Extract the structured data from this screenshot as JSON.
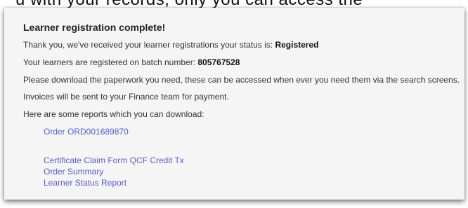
{
  "background_text": "u with your records, only you can access the",
  "heading": "Learner registration complete!",
  "messages": {
    "status_prefix": "Thank you, we've received your learner registrations your status is: ",
    "status_value": "Registered",
    "batch_prefix": "Your learners are registered on batch number: ",
    "batch_value": "805767528",
    "paperwork": "Please download the paperwork you need, these can be accessed when ever you need them via the search screens.",
    "invoices": "Invoices will be sent to your Finance team for payment.",
    "reports_intro": "Here are some reports which you can download:"
  },
  "links": {
    "order": "Order ORD001689870",
    "certificate": "Certificate Claim Form QCF Credit Tx",
    "summary": "Order Summary",
    "status_report": "Learner Status Report"
  },
  "colors": {
    "link": "#5a5acd",
    "panel": "#f5f5f5"
  }
}
